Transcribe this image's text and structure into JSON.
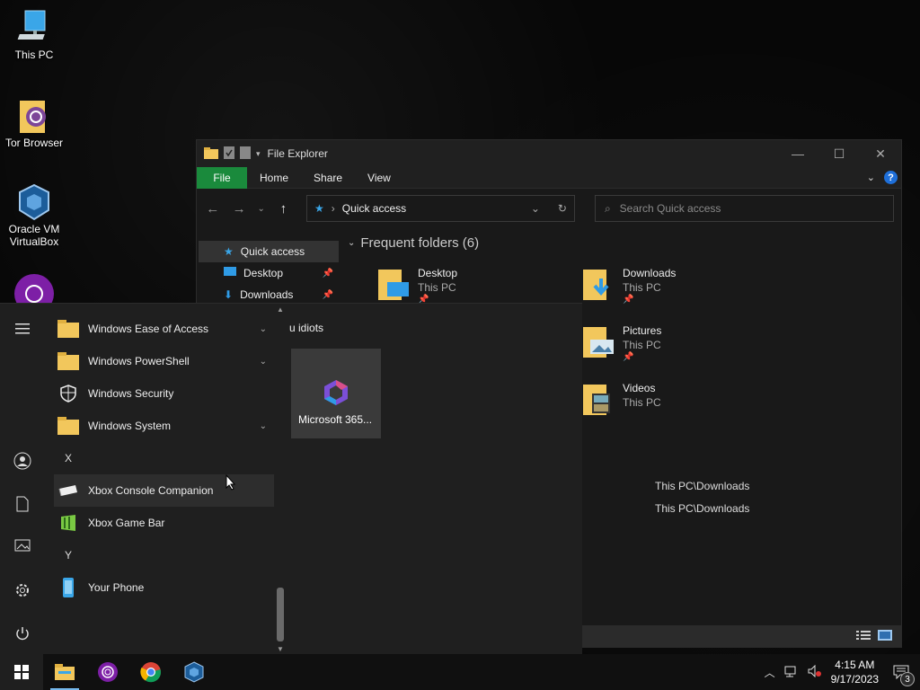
{
  "desktop": {
    "icons": [
      {
        "label": "This PC"
      },
      {
        "label": "Tor Browser"
      },
      {
        "label": "Oracle VM VirtualBox"
      }
    ]
  },
  "explorer": {
    "title": "File Explorer",
    "ribbon": {
      "file": "File",
      "home": "Home",
      "share": "Share",
      "view": "View"
    },
    "address": "Quick access",
    "search_placeholder": "Search Quick access",
    "nav": [
      {
        "label": "Quick access"
      },
      {
        "label": "Desktop"
      },
      {
        "label": "Downloads"
      }
    ],
    "group_title": "Frequent folders (6)",
    "folders": [
      {
        "name": "Desktop",
        "location": "This PC"
      },
      {
        "name": "Downloads",
        "location": "This PC"
      },
      {
        "name": "Pictures",
        "location": "This PC"
      },
      {
        "name": "Videos",
        "location": "This PC"
      }
    ],
    "recent": [
      "This PC\\Downloads",
      "This PC\\Downloads"
    ]
  },
  "start": {
    "apps": [
      {
        "label": "Windows Ease of Access"
      },
      {
        "label": "Windows PowerShell"
      },
      {
        "label": "Windows Security"
      },
      {
        "label": "Windows System"
      }
    ],
    "letter_x": "X",
    "x_apps": [
      {
        "label": "Xbox Console Companion"
      },
      {
        "label": "Xbox Game Bar"
      }
    ],
    "letter_y": "Y",
    "y_apps": [
      {
        "label": "Your Phone"
      }
    ],
    "tile_group": "u idiots",
    "tile_label": "Microsoft 365..."
  },
  "taskbar": {
    "time": "4:15 AM",
    "date": "9/17/2023",
    "notification_count": "3"
  },
  "colors": {
    "accent": "#1a8a3c",
    "taskbar": "#101010",
    "start": "#1f1f1f"
  }
}
